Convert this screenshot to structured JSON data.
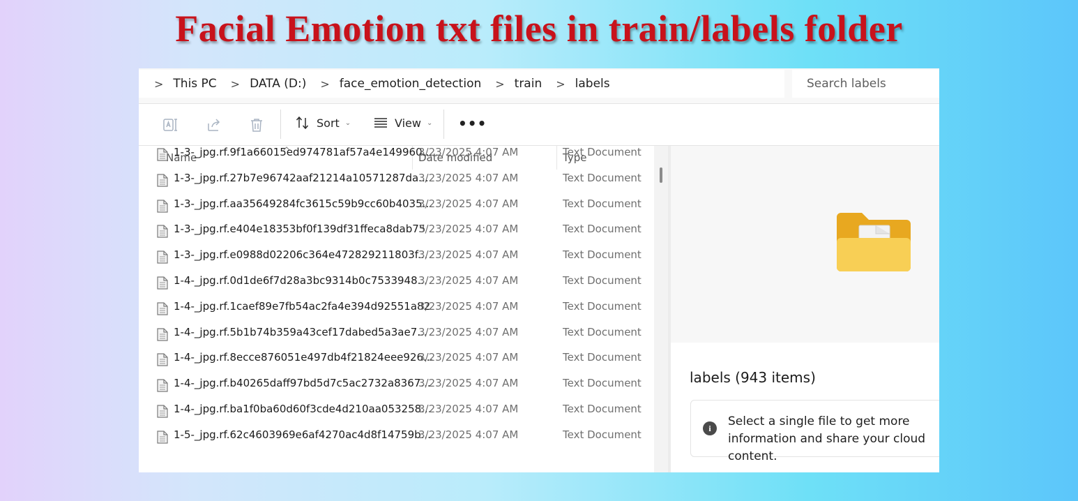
{
  "banner": {
    "title": "Facial Emotion txt files in train/labels folder"
  },
  "breadcrumb": {
    "items": [
      "This PC",
      "DATA (D:)",
      "face_emotion_detection",
      "train",
      "labels"
    ]
  },
  "search": {
    "placeholder": "Search labels"
  },
  "toolbar": {
    "rename_icon": "rename-icon",
    "share_icon": "share-icon",
    "delete_icon": "trash-icon",
    "sort_label": "Sort",
    "view_label": "View",
    "more_label": "•••"
  },
  "columns": {
    "name": "Name",
    "date": "Date modified",
    "type": "Type"
  },
  "files": [
    {
      "name": "1-3-_jpg.rf.9f1a66015ed974781af57a4e149960...",
      "date": "3/23/2025 4:07 AM",
      "type": "Text Document"
    },
    {
      "name": "1-3-_jpg.rf.27b7e96742aaf21214a10571287da...",
      "date": "3/23/2025 4:07 AM",
      "type": "Text Document"
    },
    {
      "name": "1-3-_jpg.rf.aa35649284fc3615c59b9cc60b4035...",
      "date": "3/23/2025 4:07 AM",
      "type": "Text Document"
    },
    {
      "name": "1-3-_jpg.rf.e404e18353bf0f139df31ffeca8dab75",
      "date": "3/23/2025 4:07 AM",
      "type": "Text Document"
    },
    {
      "name": "1-3-_jpg.rf.e0988d02206c364e472829211803f...",
      "date": "3/23/2025 4:07 AM",
      "type": "Text Document"
    },
    {
      "name": "1-4-_jpg.rf.0d1de6f7d28a3bc9314b0c7533948...",
      "date": "3/23/2025 4:07 AM",
      "type": "Text Document"
    },
    {
      "name": "1-4-_jpg.rf.1caef89e7fb54ac2fa4e394d92551a82",
      "date": "3/23/2025 4:07 AM",
      "type": "Text Document"
    },
    {
      "name": "1-4-_jpg.rf.5b1b74b359a43cef17dabed5a3ae7...",
      "date": "3/23/2025 4:07 AM",
      "type": "Text Document"
    },
    {
      "name": "1-4-_jpg.rf.8ecce876051e497db4f21824eee926...",
      "date": "3/23/2025 4:07 AM",
      "type": "Text Document"
    },
    {
      "name": "1-4-_jpg.rf.b40265daff97bd5d7c5ac2732a8367...",
      "date": "3/23/2025 4:07 AM",
      "type": "Text Document"
    },
    {
      "name": "1-4-_jpg.rf.ba1f0ba60d60f3cde4d210aa053258...",
      "date": "3/23/2025 4:07 AM",
      "type": "Text Document"
    },
    {
      "name": "1-5-_jpg.rf.62c4603969e6af4270ac4d8f14759b...",
      "date": "3/23/2025 4:07 AM",
      "type": "Text Document"
    }
  ],
  "details": {
    "title": "labels (943 items)",
    "info": "Select a single file to get more information and share your cloud content.",
    "folder_icon": "folder-icon"
  },
  "colors": {
    "banner_red": "#c8121b",
    "folder_yellow": "#f5c542"
  }
}
